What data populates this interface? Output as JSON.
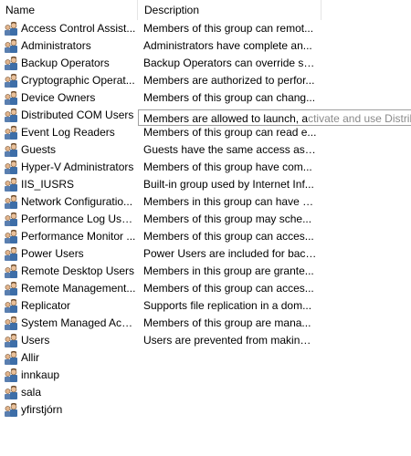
{
  "columns": {
    "name": "Name",
    "description": "Description"
  },
  "rows": [
    {
      "name": "Access Control Assist...",
      "description": "Members of this group can remot..."
    },
    {
      "name": "Administrators",
      "description": "Administrators have complete an..."
    },
    {
      "name": "Backup Operators",
      "description": "Backup Operators can override se..."
    },
    {
      "name": "Cryptographic Operat...",
      "description": "Members are authorized to perfor..."
    },
    {
      "name": "Device Owners",
      "description": "Members of this group can chang..."
    },
    {
      "name": "Distributed COM Users",
      "description": ""
    },
    {
      "name": "Event Log Readers",
      "description": "Members of this group can read e..."
    },
    {
      "name": "Guests",
      "description": "Guests have the same access as m..."
    },
    {
      "name": "Hyper-V Administrators",
      "description": "Members of this group have com..."
    },
    {
      "name": "IIS_IUSRS",
      "description": "Built-in group used by Internet Inf..."
    },
    {
      "name": "Network Configuratio...",
      "description": "Members in this group can have s..."
    },
    {
      "name": "Performance Log Users",
      "description": "Members of this group may sche..."
    },
    {
      "name": "Performance Monitor ...",
      "description": "Members of this group can acces..."
    },
    {
      "name": "Power Users",
      "description": "Power Users are included for back..."
    },
    {
      "name": "Remote Desktop Users",
      "description": "Members in this group are grante..."
    },
    {
      "name": "Remote Management...",
      "description": "Members of this group can acces..."
    },
    {
      "name": "Replicator",
      "description": "Supports file replication in a dom..."
    },
    {
      "name": "System Managed Acc...",
      "description": "Members of this group are mana..."
    },
    {
      "name": "Users",
      "description": "Users are prevented from making ..."
    },
    {
      "name": "Allir",
      "description": ""
    },
    {
      "name": "innkaup",
      "description": ""
    },
    {
      "name": "sala",
      "description": ""
    },
    {
      "name": "yfirstjórn",
      "description": ""
    }
  ],
  "tooltip": {
    "text": "Members are allowed to launch, a",
    "ghost_text": "ctivate and use Distrib"
  },
  "icon": "group-icon"
}
